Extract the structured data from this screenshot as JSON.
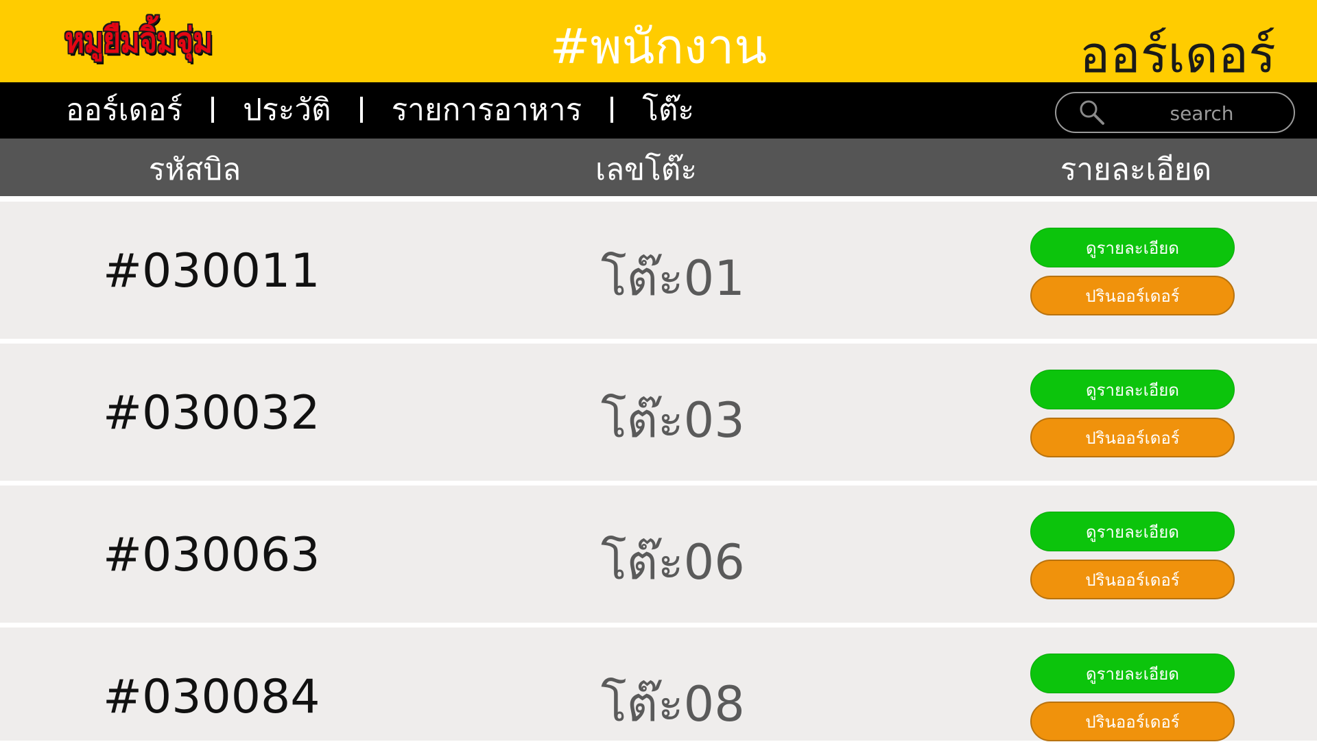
{
  "header": {
    "logo_text": "หมูยืมจิ้มจุ่ม",
    "title": "#พนักงาน",
    "page_name": "ออร์เดอร์"
  },
  "nav": {
    "items": [
      {
        "label": "ออร์เดอร์"
      },
      {
        "label": "ประวัติ"
      },
      {
        "label": "รายการอาหาร"
      },
      {
        "label": "โต๊ะ"
      }
    ]
  },
  "search": {
    "placeholder": "search",
    "icon": "search-icon"
  },
  "table": {
    "columns": [
      "รหัสบิล",
      "เลขโต๊ะ",
      "รายละเอียด"
    ],
    "rows": [
      {
        "bill_id": "#030011",
        "table_no": "โต๊ะ01",
        "detail_label": "ดูรายละเอียด",
        "print_label": "ปรินออร์เดอร์"
      },
      {
        "bill_id": "#030032",
        "table_no": "โต๊ะ03",
        "detail_label": "ดูรายละเอียด",
        "print_label": "ปรินออร์เดอร์"
      },
      {
        "bill_id": "#030063",
        "table_no": "โต๊ะ06",
        "detail_label": "ดูรายละเอียด",
        "print_label": "ปรินออร์เดอร์"
      },
      {
        "bill_id": "#030084",
        "table_no": "โต๊ะ08",
        "detail_label": "ดูรายละเอียด",
        "print_label": "ปรินออร์เดอร์"
      }
    ]
  },
  "colors": {
    "header_bg": "#FFCC00",
    "nav_bg": "#000000",
    "table_header_bg": "#555555",
    "row_bg": "#EFEDEC",
    "detail_button": "#0CC40C",
    "print_button": "#F0920C",
    "logo_red": "#E30613"
  }
}
